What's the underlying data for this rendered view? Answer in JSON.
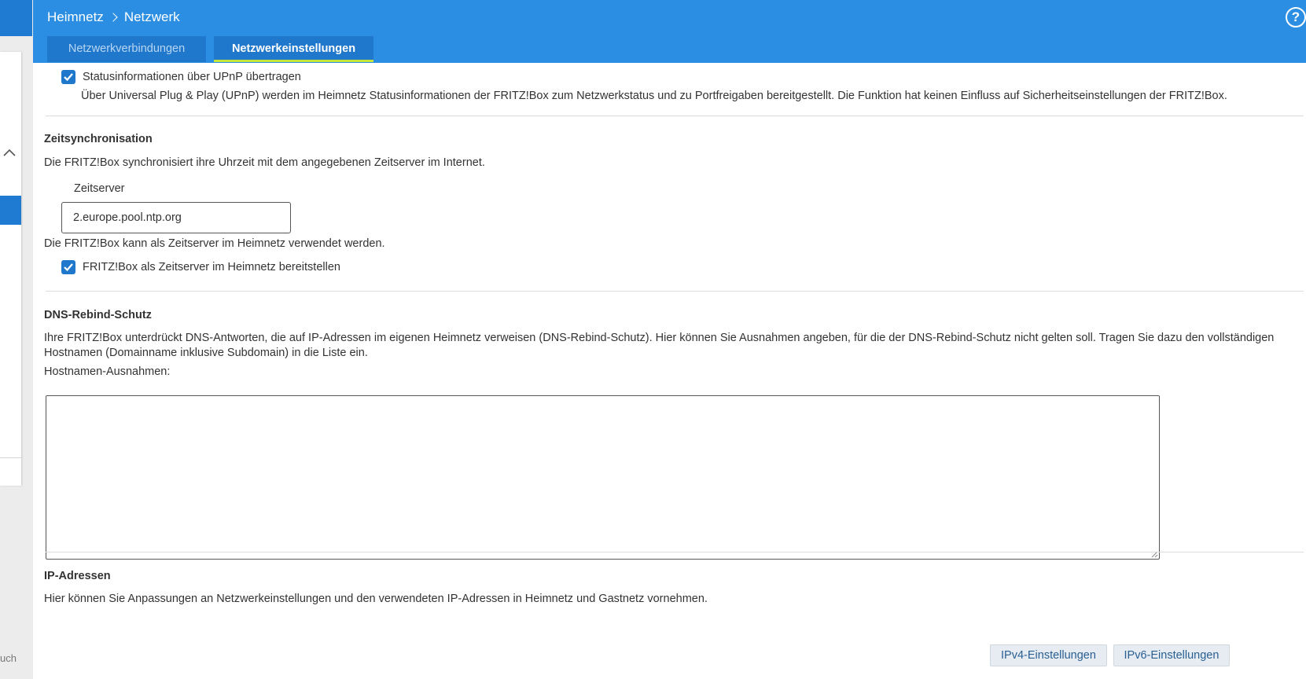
{
  "sidebar": {
    "footer_text": "uch"
  },
  "header": {
    "breadcrumb": [
      "Heimnetz",
      "Netzwerk"
    ],
    "help_icon_glyph": "?",
    "tabs": [
      {
        "label": "Netzwerkverbindungen",
        "active": false
      },
      {
        "label": "Netzwerkeinstellungen",
        "active": true
      }
    ]
  },
  "upnp": {
    "checkbox_label": "Statusinformationen über UPnP übertragen",
    "checked": true,
    "description": "Über Universal Plug & Play (UPnP) werden im Heimnetz Statusinformationen der FRITZ!Box zum Netzwerkstatus und zu Portfreigaben bereitgestellt. Die Funktion hat keinen Einfluss auf Sicherheitseinstellungen der FRITZ!Box."
  },
  "time_sync": {
    "heading": "Zeitsynchronisation",
    "description": "Die FRITZ!Box synchronisiert ihre Uhrzeit mit dem angegebenen Zeitserver im Internet.",
    "server_label": "Zeitserver",
    "server_value": "2.europe.pool.ntp.org",
    "note": "Die FRITZ!Box kann als Zeitserver im Heimnetz verwendet werden.",
    "provide_label": "FRITZ!Box als Zeitserver im Heimnetz bereitstellen",
    "provide_checked": true
  },
  "dns_rebind": {
    "heading": "DNS-Rebind-Schutz",
    "description_line1": "Ihre FRITZ!Box unterdrückt DNS-Antworten, die auf IP-Adressen im eigenen Heimnetz verweisen (DNS-Rebind-Schutz). Hier können Sie Ausnahmen angeben, für die der DNS-Rebind-Schutz nicht gelten soll. Tragen Sie dazu den vollständigen",
    "description_line2": "Hostnamen (Domainname inklusive Subdomain) in die Liste ein.",
    "exceptions_label": "Hostnamen-Ausnahmen:",
    "exceptions_value": ""
  },
  "ip": {
    "heading": "IP-Adressen",
    "description": "Hier können Sie Anpassungen an Netzwerkeinstellungen und den verwendeten IP-Adressen in Heimnetz und Gastnetz vornehmen.",
    "ipv4_button": "IPv4-Einstellungen",
    "ipv6_button": "IPv6-Einstellungen"
  },
  "colors": {
    "header": "#2b8ee3",
    "tab": "#1f78cc",
    "active_tab_underline": "#c8e63a",
    "checkbox": "#1f78cc"
  }
}
